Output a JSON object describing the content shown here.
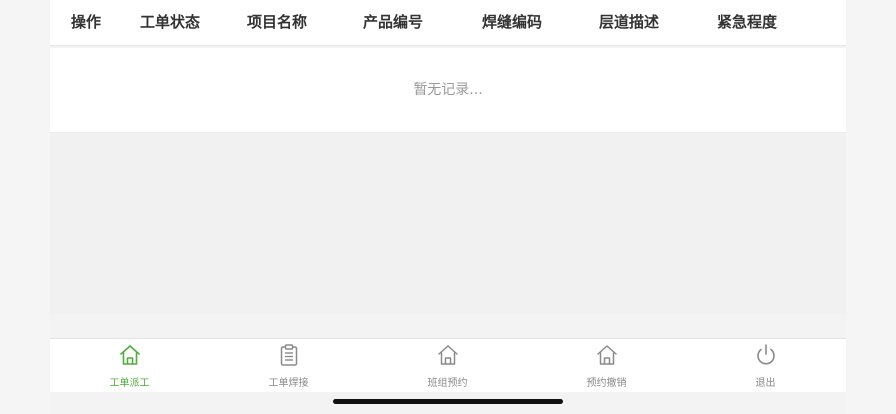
{
  "table": {
    "columns": [
      "操作",
      "工单状态",
      "项目名称",
      "产品编号",
      "焊缝编码",
      "层道描述",
      "紧急程度"
    ],
    "empty_text": "暂无记录..."
  },
  "tabbar": {
    "items": [
      {
        "label": "工单派工",
        "icon": "home-icon",
        "active": true
      },
      {
        "label": "工单焊接",
        "icon": "clipboard-icon",
        "active": false
      },
      {
        "label": "班组预约",
        "icon": "home-icon",
        "active": false
      },
      {
        "label": "预约撤销",
        "icon": "home-icon",
        "active": false
      },
      {
        "label": "退出",
        "icon": "power-icon",
        "active": false
      }
    ]
  },
  "colors": {
    "accent": "#4caf3a",
    "inactive": "#8a8a8a"
  }
}
